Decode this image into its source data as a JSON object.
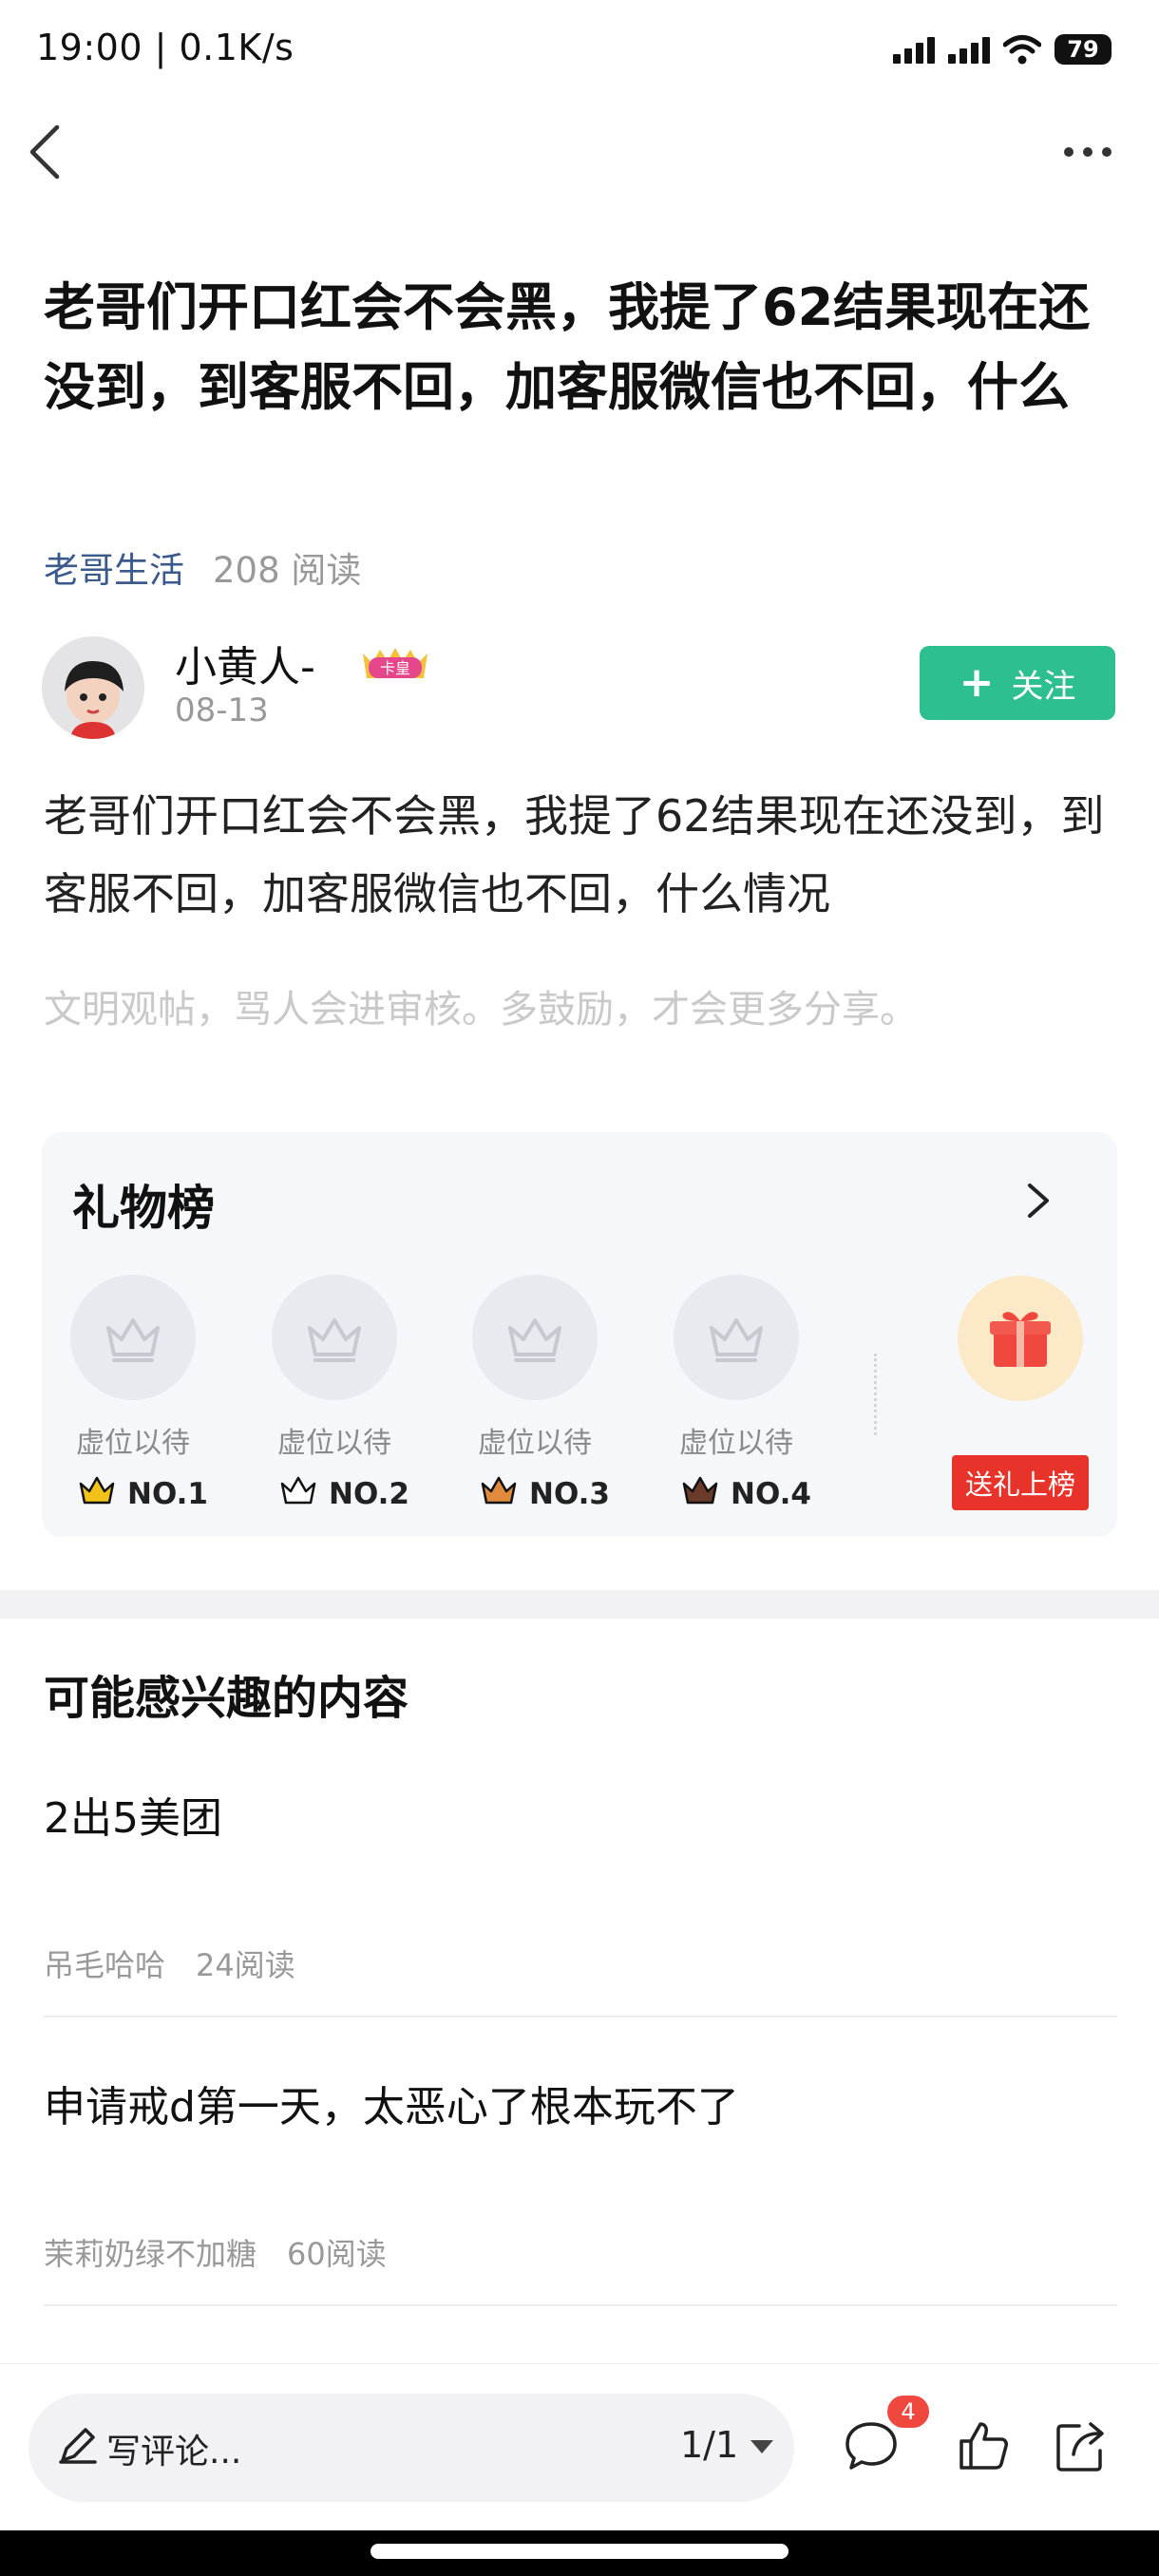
{
  "status_bar": {
    "time": "19:00 | 0.1K/s",
    "battery": "79"
  },
  "post": {
    "title": "老哥们开口红会不会黑，我提了62结果现在还没到，到客服不回，加客服微信也不回，什么",
    "category": "老哥生活",
    "reads": "208 阅读",
    "author": {
      "name": "小黄人-",
      "badge": "卡皇",
      "date": "08-13"
    },
    "follow_label": "关注",
    "body": "老哥们开口红会不会黑，我提了62结果现在还没到，到客服不回，加客服微信也不回，什么情况",
    "civility_note": "文明观帖，骂人会进审核。多鼓励，才会更多分享。"
  },
  "gift_board": {
    "title": "礼物榜",
    "slots": [
      {
        "label": "虚位以待",
        "rank": "NO.1",
        "crown_color": "#f2c21b"
      },
      {
        "label": "虚位以待",
        "rank": "NO.2",
        "crown_color": "#ffffff"
      },
      {
        "label": "虚位以待",
        "rank": "NO.3",
        "crown_color": "#e08a3c"
      },
      {
        "label": "虚位以待",
        "rank": "NO.4",
        "crown_color": "#6b3a2a"
      }
    ],
    "send_button": "送礼上榜"
  },
  "recommendations": {
    "heading": "可能感兴趣的内容",
    "items": [
      {
        "title": "2出5美团",
        "author": "吊毛哈哈",
        "reads": "24阅读"
      },
      {
        "title": "申请戒d第一天，太恶心了根本玩不了",
        "author": "茉莉奶绿不加糖",
        "reads": "60阅读"
      }
    ]
  },
  "bottom_bar": {
    "comment_placeholder": "写评论...",
    "page_indicator": "1/1",
    "comment_count": "4"
  },
  "colors": {
    "accent_green": "#2ebf91",
    "category_blue": "#3a5a8c",
    "badge_red": "#f0473f"
  }
}
